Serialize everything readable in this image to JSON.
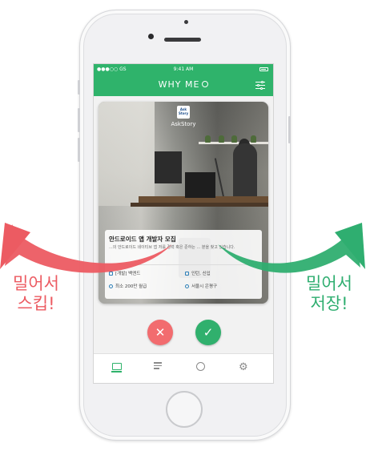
{
  "status_bar": {
    "carrier": "●●●○○ GS",
    "time": "9:41 AM"
  },
  "header": {
    "brand": "WHY ME"
  },
  "card": {
    "company_logo_text": "Ask Story",
    "company_name": "AskStory",
    "title": "안드로이드 앱 개발자 모집",
    "description": "...의 안드로이드 네이티브 앱 저를 경력 혹은 준하는 ... 분을 찾고 있습니다.",
    "tags": {
      "field": "[개발] 백엔드",
      "type": "인턴, 신입",
      "salary": "최소 200만 월급",
      "location": "서울시 은평구"
    }
  },
  "actions": {
    "skip_symbol": "✕",
    "save_symbol": "✓"
  },
  "gesture_labels": {
    "left_line1": "밀어서",
    "left_line2": "스킵!",
    "right_line1": "밀어서",
    "right_line2": "저장!"
  },
  "colors": {
    "brand_green": "#2fb36b",
    "skip_red": "#f26c6f",
    "arrow_red": "#ec5b62",
    "arrow_green": "#2fae70"
  },
  "tabs": [
    {
      "icon": "monitor-icon",
      "active": true
    },
    {
      "icon": "checklist-icon",
      "active": false
    },
    {
      "icon": "chat-icon",
      "active": false
    },
    {
      "icon": "gear-icon",
      "active": false
    }
  ]
}
